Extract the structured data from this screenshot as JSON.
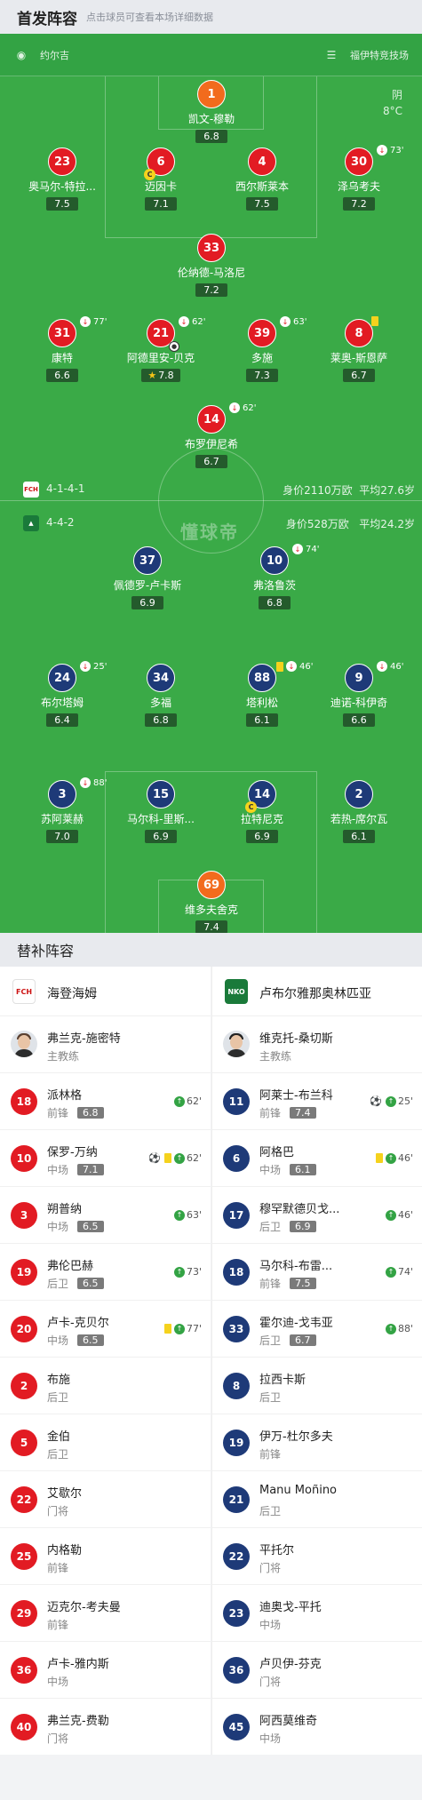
{
  "header": {
    "title": "首发阵容",
    "hint": "点击球员可查看本场详细数据"
  },
  "match": {
    "referee": "约尔吉",
    "stadium": "福伊特竞技场",
    "weather": "阴",
    "temp": "8°C",
    "watermark": "懂球帝"
  },
  "home": {
    "formation": "4-1-4-1",
    "value": "身价2110万欧",
    "age": "平均27.6岁",
    "badge": "FCH"
  },
  "away": {
    "formation": "4-4-2",
    "value": "身价528万欧",
    "age": "平均24.2岁"
  },
  "home_players": [
    {
      "num": "1",
      "name": "凯文-穆勒",
      "rating": "6.8",
      "kit": "gk"
    },
    {
      "num": "23",
      "name": "奥马尔-特拉...",
      "rating": "7.5"
    },
    {
      "num": "6",
      "name": "迈因卡",
      "rating": "7.1",
      "captain": "C"
    },
    {
      "num": "4",
      "name": "西尔斯莱本",
      "rating": "7.5"
    },
    {
      "num": "30",
      "name": "泽乌考夫",
      "rating": "7.2",
      "sub": "73'"
    },
    {
      "num": "33",
      "name": "伦纳德-马洛尼",
      "rating": "7.2"
    },
    {
      "num": "31",
      "name": "康特",
      "rating": "6.6",
      "sub": "77'"
    },
    {
      "num": "21",
      "name": "阿德里安-贝克",
      "rating": "7.8",
      "sub": "62'"
    },
    {
      "num": "39",
      "name": "多施",
      "rating": "7.3",
      "sub": "63'"
    },
    {
      "num": "8",
      "name": "莱奥-斯恩萨",
      "rating": "6.7"
    },
    {
      "num": "14",
      "name": "布罗伊尼希",
      "rating": "6.7",
      "sub": "62'"
    }
  ],
  "away_players": [
    {
      "num": "37",
      "name": "佩德罗-卢卡斯",
      "rating": "6.9"
    },
    {
      "num": "10",
      "name": "弗洛鲁茨",
      "rating": "6.8",
      "sub": "74'"
    },
    {
      "num": "24",
      "name": "布尔塔姆",
      "rating": "6.4",
      "sub": "25'"
    },
    {
      "num": "34",
      "name": "多福",
      "rating": "6.8"
    },
    {
      "num": "88",
      "name": "塔利松",
      "rating": "6.1",
      "sub": "46'"
    },
    {
      "num": "9",
      "name": "迪诺-科伊奇",
      "rating": "6.6",
      "sub": "46'"
    },
    {
      "num": "3",
      "name": "苏阿莱赫",
      "rating": "7.0",
      "sub": "88'"
    },
    {
      "num": "15",
      "name": "马尔科-里斯...",
      "rating": "6.9"
    },
    {
      "num": "14",
      "name": "拉特尼克",
      "rating": "6.9",
      "captain": "C"
    },
    {
      "num": "2",
      "name": "若热-席尔瓦",
      "rating": "6.1"
    },
    {
      "num": "69",
      "name": "维多夫舍克",
      "rating": "7.4",
      "kit": "gk"
    }
  ],
  "subs": {
    "title": "替补阵容",
    "home": {
      "team": "海登海姆",
      "logo": "FCH",
      "coach": "弗兰克-施密特",
      "coach_role": "主教练",
      "players": [
        {
          "num": "18",
          "name": "派林格",
          "pos": "前锋",
          "rating": "6.8",
          "ev": "62'"
        },
        {
          "num": "10",
          "name": "保罗-万纳",
          "pos": "中场",
          "rating": "7.1",
          "ev": "62'"
        },
        {
          "num": "3",
          "name": "朔普纳",
          "pos": "中场",
          "rating": "6.5",
          "ev": "63'"
        },
        {
          "num": "19",
          "name": "弗伦巴赫",
          "pos": "后卫",
          "rating": "6.5",
          "ev": "73'"
        },
        {
          "num": "20",
          "name": "卢卡-克贝尔",
          "pos": "中场",
          "rating": "6.5",
          "ev": "77'"
        },
        {
          "num": "2",
          "name": "布施",
          "pos": "后卫"
        },
        {
          "num": "5",
          "name": "金伯",
          "pos": "后卫"
        },
        {
          "num": "22",
          "name": "艾歇尔",
          "pos": "门将"
        },
        {
          "num": "25",
          "name": "内格勒",
          "pos": "前锋"
        },
        {
          "num": "29",
          "name": "迈克尔-考夫曼",
          "pos": "前锋"
        },
        {
          "num": "36",
          "name": "卢卡-雅内斯",
          "pos": "中场"
        },
        {
          "num": "40",
          "name": "弗兰克-费勒",
          "pos": "门将"
        }
      ]
    },
    "away": {
      "team": "卢布尔雅那奥林匹亚",
      "logo": "NKO",
      "coach": "维克托-桑切斯",
      "coach_role": "主教练",
      "players": [
        {
          "num": "11",
          "name": "阿莱士-布兰科",
          "pos": "前锋",
          "rating": "7.4",
          "ev": "25'"
        },
        {
          "num": "6",
          "name": "阿格巴",
          "pos": "中场",
          "rating": "6.1",
          "ev": "46'"
        },
        {
          "num": "17",
          "name": "穆罕默德贝戈...",
          "pos": "后卫",
          "rating": "6.9",
          "ev": "46'"
        },
        {
          "num": "18",
          "name": "马尔科-布雷...",
          "pos": "前锋",
          "rating": "7.5",
          "ev": "74'"
        },
        {
          "num": "33",
          "name": "霍尔迪-戈韦亚",
          "pos": "后卫",
          "rating": "6.7",
          "ev": "88'"
        },
        {
          "num": "8",
          "name": "拉西卡斯",
          "pos": "后卫"
        },
        {
          "num": "19",
          "name": "伊万-杜尔多夫",
          "pos": "前锋"
        },
        {
          "num": "21",
          "name": "Manu Moñino",
          "pos": "后卫"
        },
        {
          "num": "22",
          "name": "平托尔",
          "pos": "门将"
        },
        {
          "num": "23",
          "name": "迪奥戈-平托",
          "pos": "中场"
        },
        {
          "num": "36",
          "name": "卢贝伊-芬克",
          "pos": "门将"
        },
        {
          "num": "45",
          "name": "阿西莫维奇",
          "pos": "中场"
        }
      ]
    }
  },
  "colors": {
    "pitch": "#3aaa47",
    "home": "#e21b23",
    "away": "#1e3a78",
    "gk": "#f26b1d"
  }
}
